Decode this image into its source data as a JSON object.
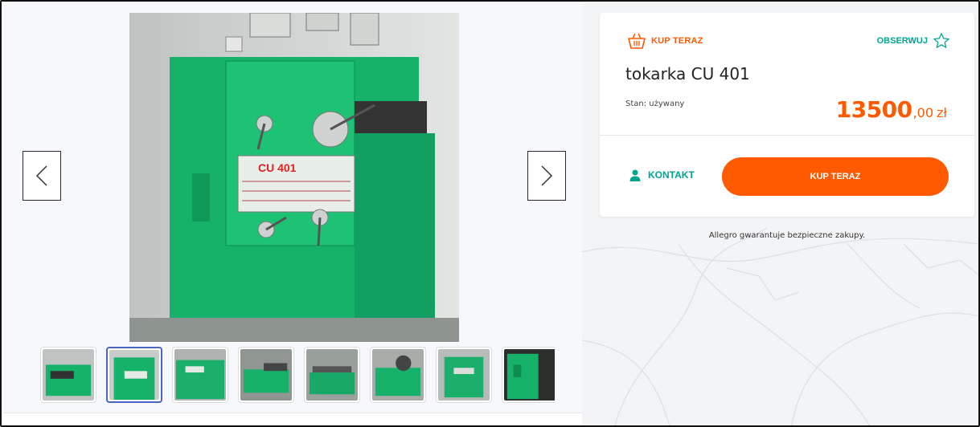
{
  "gallery": {
    "prev_icon": "chevron-left-icon",
    "next_icon": "chevron-right-icon",
    "thumbnail_count": 8,
    "selected_thumbnail_index": 1,
    "main_image_label": "CU 401"
  },
  "offer": {
    "buy_tag_label": "KUP TERAZ",
    "buy_tag_icon": "basket-icon",
    "watch_label": "OBSERWUJ",
    "watch_icon": "star-outline-icon",
    "title": "tokarka CU 401",
    "condition": "Stan: używany",
    "price_integer": "13500",
    "price_decimal": ",00",
    "price_currency": "zł",
    "contact_label": "KONTAKT",
    "contact_icon": "person-icon",
    "buy_button_label": "KUP TERAZ"
  },
  "guarantee_text": "Allegro gwarantuje bezpieczne zakupy.",
  "colors": {
    "accent_orange": "#ff5a00",
    "accent_teal": "#00a790",
    "selected_border": "#4a64c4",
    "machine_green": "#17b26a"
  }
}
